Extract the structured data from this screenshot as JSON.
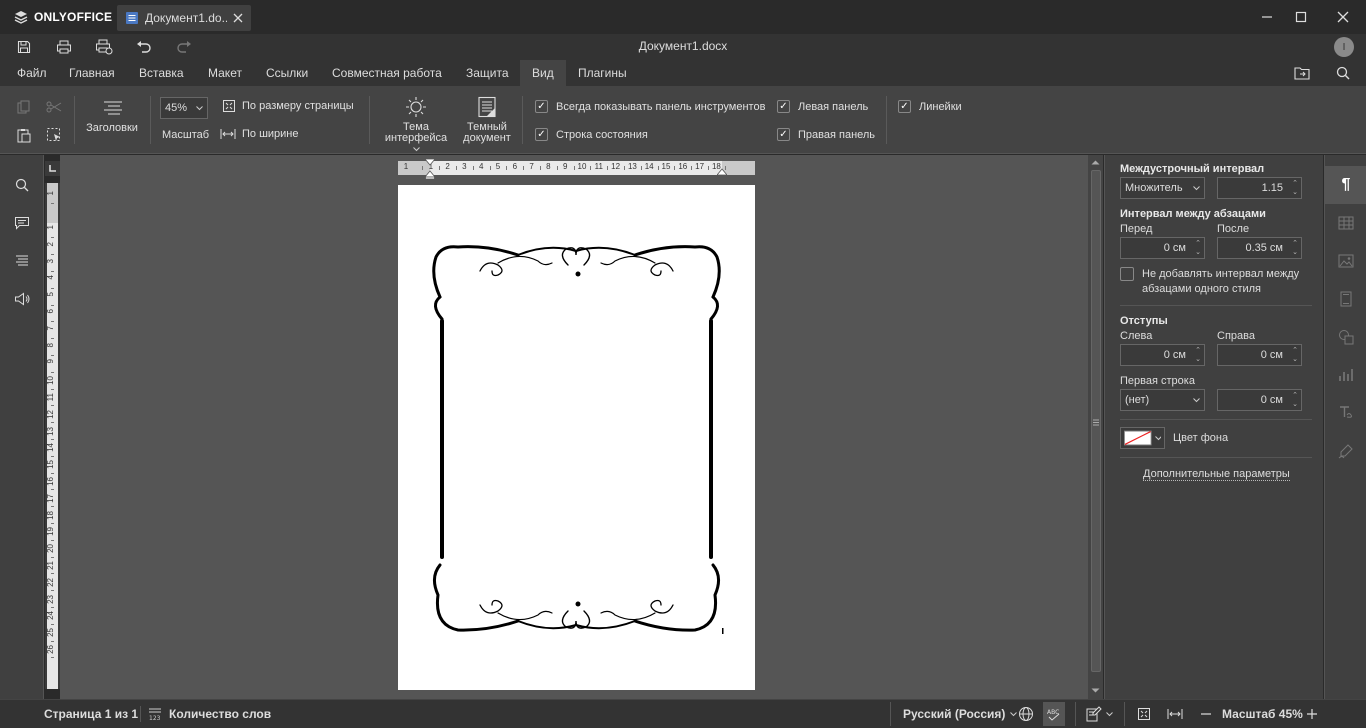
{
  "app": {
    "brand": "ONLYOFFICE",
    "tab_title": "Документ1.do...",
    "doc_title": "Документ1.docx",
    "user_initial": "I"
  },
  "menu": {
    "tabs": [
      "Файл",
      "Главная",
      "Вставка",
      "Макет",
      "Ссылки",
      "Совместная работа",
      "Защита",
      "Вид",
      "Плагины"
    ],
    "active_tab": "Вид"
  },
  "ribbon": {
    "headings_label": "Заголовки",
    "zoom_value": "45%",
    "zoom_label": "Масштаб",
    "fit_page_label": "По размеру страницы",
    "fit_width_label": "По ширине",
    "theme_label_1": "Тема",
    "theme_label_2": "интерфейса",
    "dark_doc_label_1": "Темный",
    "dark_doc_label_2": "документ",
    "always_toolbar_label": "Всегда показывать панель инструментов",
    "statusbar_label": "Строка состояния",
    "left_panel_label": "Левая панель",
    "right_panel_label": "Правая панель",
    "rulers_label": "Линейки"
  },
  "ruler": {
    "h_ticks": [
      "1",
      "1",
      "2",
      "3",
      "4",
      "5",
      "6",
      "7",
      "8",
      "9",
      "10",
      "11",
      "12",
      "13",
      "14",
      "15",
      "16",
      "17",
      "18"
    ],
    "v_ticks": [
      "1",
      "1",
      "2",
      "3",
      "4",
      "5",
      "6",
      "7",
      "8",
      "9",
      "10",
      "11",
      "12",
      "13",
      "14",
      "15",
      "16",
      "17",
      "18",
      "19",
      "20",
      "21",
      "22",
      "23",
      "24",
      "25",
      "26"
    ]
  },
  "paragraph_panel": {
    "line_spacing_title": "Междустрочный интервал",
    "line_spacing_type": "Множитель",
    "line_spacing_value": "1.15",
    "para_spacing_title": "Интервал между абзацами",
    "before_label": "Перед",
    "before_value": "0 см",
    "after_label": "После",
    "after_value": "0.35 см",
    "no_spacing_label_1": "Не добавлять интервал между",
    "no_spacing_label_2": "абзацами одного стиля",
    "indents_title": "Отступы",
    "left_label": "Слева",
    "left_value": "0 см",
    "right_label": "Справа",
    "right_value": "0 см",
    "first_line_label": "Первая строка",
    "first_line_type": "(нет)",
    "first_line_value": "0 см",
    "bg_color_label": "Цвет фона",
    "advanced_link": "Дополнительные параметры"
  },
  "status": {
    "page_info": "Страница 1 из 1",
    "word_count": "Количество слов",
    "language": "Русский (Россия)",
    "zoom": "Масштаб 45%"
  },
  "colors": {
    "accent_bg": "#444444",
    "page": "#ffffff",
    "canvas": "#555555"
  }
}
